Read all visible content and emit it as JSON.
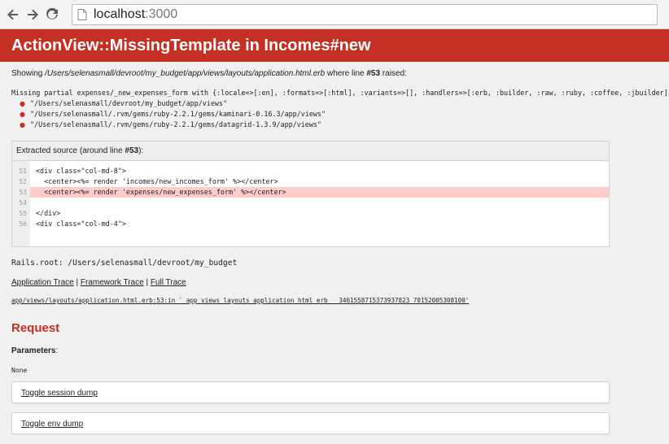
{
  "browser": {
    "host": "localhost",
    "port": ":3000"
  },
  "header": {
    "title": "ActionView::MissingTemplate in Incomes#new"
  },
  "showing": {
    "prefix": "Showing ",
    "path": "/Users/selenasmall/devroot/my_budget/app/views/layouts/application.html.erb",
    "middle": " where line ",
    "line": "#53",
    "suffix": " raised:"
  },
  "error": {
    "message": "Missing partial expenses/_new_expenses_form with {:locale=>[:en], :formats=>[:html], :variants=>[], :handlers=>[:erb, :builder, :raw, :ruby, :coffee, :jbuilder]}. Searched in:",
    "paths": [
      "\"/Users/selenasmall/devroot/my_budget/app/views\"",
      "\"/Users/selenasmall/.rvm/gems/ruby-2.2.1/gems/kaminari-0.16.3/app/views\"",
      "\"/Users/selenasmall/.rvm/gems/ruby-2.2.1/gems/datagrid-1.3.9/app/views\""
    ]
  },
  "source": {
    "header_prefix": "Extracted source (around line ",
    "header_line": "#53",
    "header_suffix": "):",
    "line_numbers": [
      "51",
      "52",
      "53",
      "54",
      "55",
      "56"
    ],
    "lines": [
      "<div class=\"col-md-8\">",
      "  <center><%= render 'incomes/new_incomes_form' %></center>",
      "  <center><%= render 'expenses/new_expenses_form' %></center>",
      "",
      "</div>",
      "<div class=\"col-md-4\">"
    ]
  },
  "rails_root": "Rails.root: /Users/selenasmall/devroot/my_budget",
  "traces": {
    "application": "Application Trace",
    "framework": "Framework Trace",
    "full": "Full Trace",
    "separator": " | ",
    "first_line": "app/views/layouts/application.html.erb:53:in `_app_views_layouts_application_html_erb___3461558715373937823_70152005308100'"
  },
  "request": {
    "title": "Request",
    "parameters_label": "Parameters",
    "parameters_colon": ":",
    "parameters_value": "None",
    "toggle_session": "Toggle session dump",
    "toggle_env": "Toggle env dump"
  },
  "colors": {
    "header_red": "#c52f24",
    "highlight": "#ffcccc"
  }
}
